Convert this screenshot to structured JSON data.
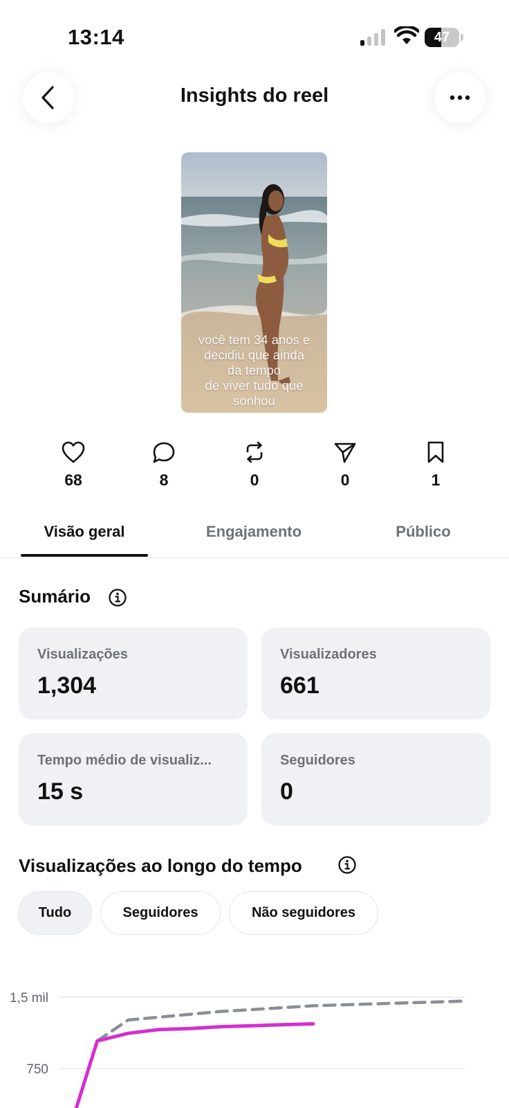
{
  "status_bar": {
    "time": "13:14",
    "battery": "47",
    "battery_level": 0.47
  },
  "header": {
    "title": "Insights do reel",
    "back_icon": "chevron-left-icon",
    "more_icon": "ellipsis-icon"
  },
  "reel": {
    "caption_lines": [
      "você tem 34 anos e",
      "decidiu que ainda",
      "da tempo",
      "de viver tudo que",
      "sonhou"
    ]
  },
  "stats": [
    {
      "icon": "heart-icon",
      "value": "68"
    },
    {
      "icon": "comment-icon",
      "value": "8"
    },
    {
      "icon": "repost-icon",
      "value": "0"
    },
    {
      "icon": "send-icon",
      "value": "0"
    },
    {
      "icon": "bookmark-icon",
      "value": "1"
    }
  ],
  "tabs": [
    {
      "label": "Visão geral",
      "active": true
    },
    {
      "label": "Engajamento",
      "active": false
    },
    {
      "label": "Público",
      "active": false
    }
  ],
  "summary": {
    "title": "Sumário",
    "cards": [
      {
        "label": "Visualizações",
        "value": "1,304"
      },
      {
        "label": "Visualizadores",
        "value": "661"
      },
      {
        "label": "Tempo médio de visualiz...",
        "value": "15 s"
      },
      {
        "label": "Seguidores",
        "value": "0"
      }
    ]
  },
  "views_over_time": {
    "title": "Visualizações ao longo do tempo",
    "filters": [
      {
        "label": "Tudo",
        "active": true
      },
      {
        "label": "Seguidores",
        "active": false
      },
      {
        "label": "Não seguidores",
        "active": false
      }
    ]
  },
  "chart_data": {
    "type": "line",
    "y_ticks": [
      {
        "label": "1,5 mil",
        "value": 1500
      },
      {
        "label": "750",
        "value": 750
      }
    ],
    "ylim": [
      0,
      1500
    ],
    "grid": true,
    "series": [
      {
        "style": "solid",
        "color": "#d42fcf",
        "x": [
          0,
          1,
          2,
          3,
          4,
          5,
          6,
          7,
          8
        ],
        "values": [
          0,
          1040,
          1120,
          1160,
          1170,
          1190,
          1200,
          1210,
          1220
        ]
      },
      {
        "style": "dashed",
        "color": "#8a8f96",
        "x": [
          1,
          2,
          3,
          4,
          5,
          6,
          7,
          8,
          9,
          10,
          11,
          12,
          13
        ],
        "values": [
          1040,
          1260,
          1290,
          1320,
          1350,
          1370,
          1390,
          1410,
          1420,
          1430,
          1440,
          1450,
          1460
        ]
      }
    ],
    "colors": {
      "solid": "#d42fcf",
      "dashed": "#8a8f96",
      "grid": "#e6e8eb"
    }
  }
}
